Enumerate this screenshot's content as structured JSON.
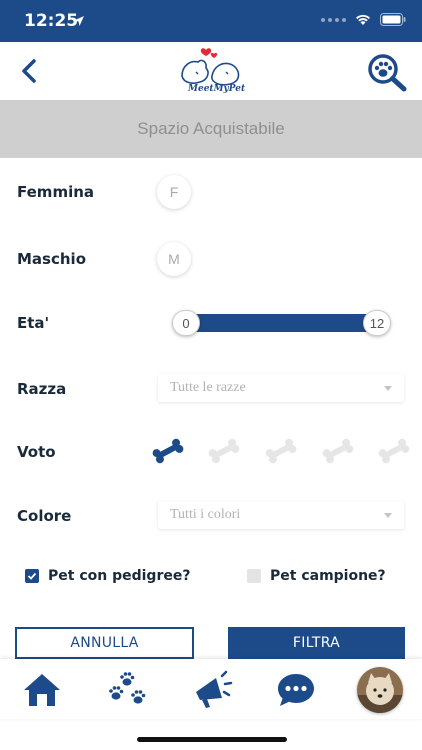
{
  "status_bar": {
    "time": "12:25"
  },
  "header": {
    "logo_text": "MeetMyPet"
  },
  "ad_banner": {
    "text": "Spazio Acquistabile"
  },
  "filters": {
    "female": {
      "label": "Femmina",
      "toggle": "F"
    },
    "male": {
      "label": "Maschio",
      "toggle": "M"
    },
    "age": {
      "label": "Eta'",
      "min": "0",
      "max": "12"
    },
    "breed": {
      "label": "Razza",
      "value": "Tutte le razze"
    },
    "rating": {
      "label": "Voto",
      "value": 1,
      "max": 5
    },
    "color": {
      "label": "Colore",
      "value": "Tutti i colori"
    },
    "pedigree": {
      "label": "Pet con pedigree?",
      "checked": true
    },
    "champion": {
      "label": "Pet campione?",
      "checked": false
    }
  },
  "buttons": {
    "cancel": "ANNULLA",
    "filter": "FILTRA"
  },
  "nav": {
    "items": [
      "home-icon",
      "paw-icon",
      "megaphone-icon",
      "chat-icon",
      "profile-avatar"
    ]
  },
  "colors": {
    "primary": "#1d4b8a",
    "banner": "#cfcfcf",
    "inactive_bone": "#e6e6e6"
  }
}
